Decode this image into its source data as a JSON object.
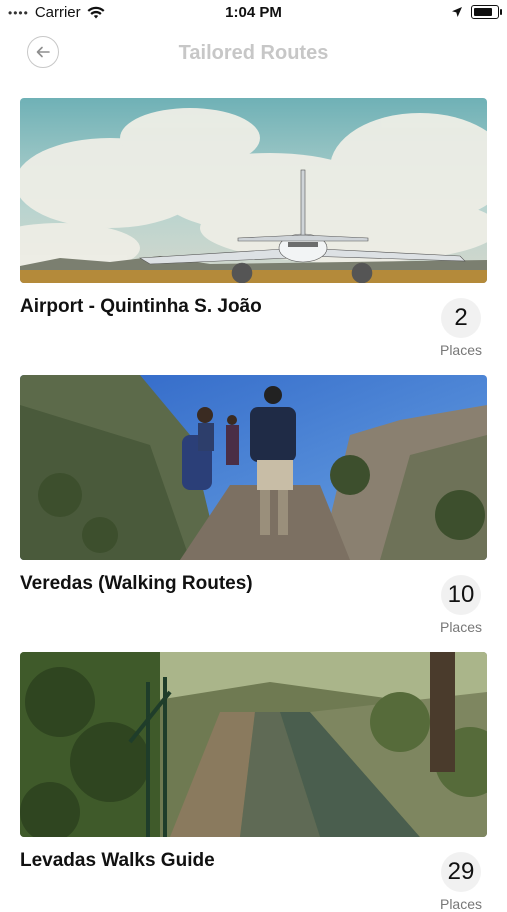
{
  "status": {
    "carrier": "Carrier",
    "time": "1:04 PM"
  },
  "header": {
    "title": "Tailored Routes"
  },
  "routes": [
    {
      "title": "Airport - Quintinha S. João",
      "count": "2",
      "unit": "Places"
    },
    {
      "title": "Veredas (Walking Routes)",
      "count": "10",
      "unit": "Places"
    },
    {
      "title": "Levadas Walks Guide",
      "count": "29",
      "unit": "Places"
    }
  ],
  "colors": {
    "accent_text": "#c7c7c7",
    "bubble": "#f1f1f1"
  }
}
